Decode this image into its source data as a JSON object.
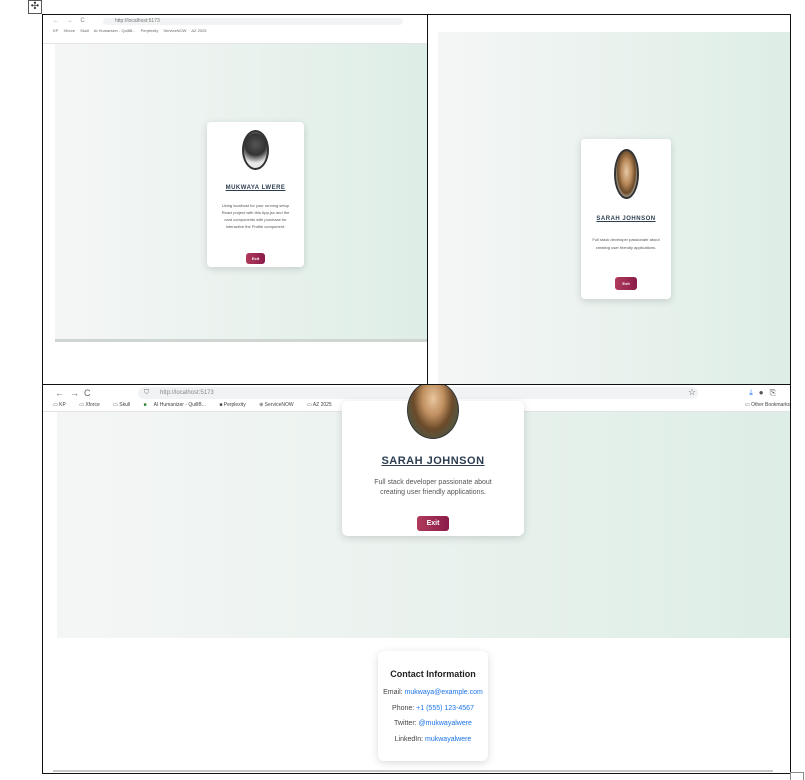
{
  "handle_glyph": "✣",
  "panel1": {
    "tabs_glyphs": "← → C",
    "url": "http://localhost:5173",
    "bookmarks": [
      "KP",
      "Xforce",
      "Skull",
      "AI Humanizer - QuillB...",
      "Perplexity",
      "ServiceNOW",
      "AZ 2025"
    ],
    "card": {
      "name": "MUKWAYA LWERE",
      "bio": "Using localhost for your running setup React project with this App.jsx and the card components with purchase for interactive the Profile component.",
      "exit": "Exit"
    }
  },
  "panel2": {
    "card": {
      "name": "SARAH JOHNSON",
      "bio": "Full stack developer passionate about creating user friendly applications.",
      "exit": "Exit"
    }
  },
  "panel3": {
    "nav": {
      "back": "←",
      "forward": "→",
      "reload": "C"
    },
    "url": "http://localhost:5173",
    "bookmarks": [
      "KP",
      "Xforce",
      "Skull",
      "AI Humanizer - QuillB...",
      "Perplexity",
      "ServiceNOW",
      "AZ 2025"
    ],
    "other_bookmarks": "Other Bookmarks",
    "card": {
      "name": "SARAH JOHNSON",
      "bio": "Full stack developer passionate about creating user friendly applications.",
      "exit": "Exit"
    },
    "contact": {
      "title": "Contact Information",
      "email_label": "Email:",
      "email": "mukwaya@example.com",
      "phone_label": "Phone:",
      "phone": "+1 (555) 123-4567",
      "twitter_label": "Twitter:",
      "twitter": "@mukwayalwere",
      "linkedin_label": "LinkedIn:",
      "linkedin": "mukwayalwere"
    }
  }
}
